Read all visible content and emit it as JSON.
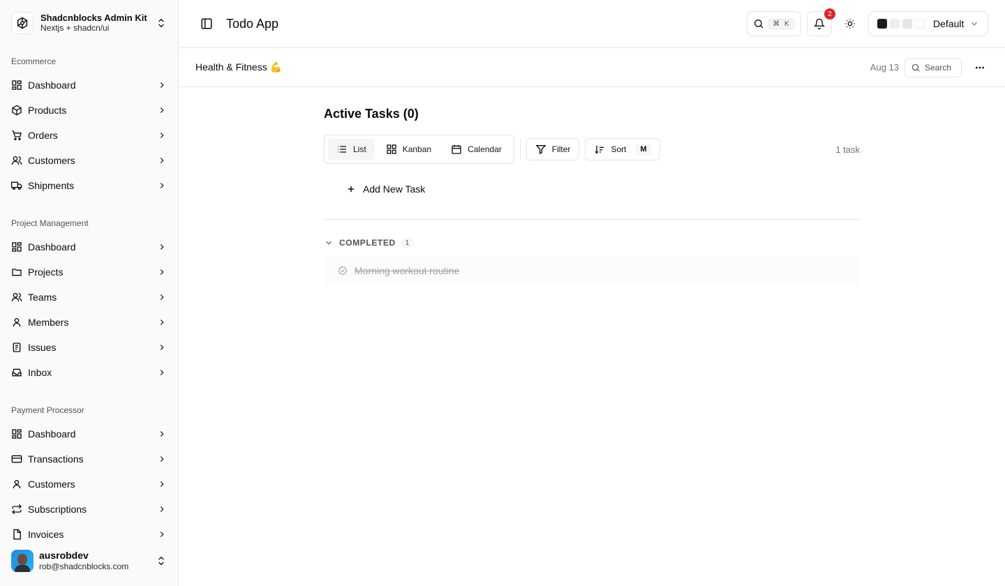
{
  "brand": {
    "title": "Shadcnblocks Admin Kit",
    "subtitle": "Nextjs + shadcn/ui"
  },
  "sidebar": {
    "groups": [
      {
        "label": "Ecommerce",
        "items": [
          {
            "label": "Dashboard",
            "icon": "dashboard-icon"
          },
          {
            "label": "Products",
            "icon": "package-icon"
          },
          {
            "label": "Orders",
            "icon": "cart-icon"
          },
          {
            "label": "Customers",
            "icon": "users-icon"
          },
          {
            "label": "Shipments",
            "icon": "truck-icon"
          }
        ]
      },
      {
        "label": "Project Management",
        "items": [
          {
            "label": "Dashboard",
            "icon": "dashboard-icon"
          },
          {
            "label": "Projects",
            "icon": "folder-icon"
          },
          {
            "label": "Teams",
            "icon": "users-icon"
          },
          {
            "label": "Members",
            "icon": "user-icon"
          },
          {
            "label": "Issues",
            "icon": "issues-icon"
          },
          {
            "label": "Inbox",
            "icon": "inbox-icon"
          }
        ]
      },
      {
        "label": "Payment Processor",
        "items": [
          {
            "label": "Dashboard",
            "icon": "dashboard-icon"
          },
          {
            "label": "Transactions",
            "icon": "credit-card-icon"
          },
          {
            "label": "Customers",
            "icon": "user-icon"
          },
          {
            "label": "Subscriptions",
            "icon": "repeat-icon"
          },
          {
            "label": "Invoices",
            "icon": "file-icon"
          }
        ]
      }
    ]
  },
  "user": {
    "name": "ausrobdev",
    "email": "rob@shadcnblocks.com"
  },
  "topbar": {
    "title": "Todo App",
    "search_shortcut": "⌘ K",
    "notification_count": "2",
    "theme_label": "Default",
    "theme_swatches": [
      "#1c1c1c",
      "#eeeeee",
      "#e6e6e6",
      "#ffffff"
    ]
  },
  "subbar": {
    "list_title": "Health & Fitness 💪",
    "date": "Aug 13",
    "search_placeholder": "Search"
  },
  "content": {
    "section_title": "Active Tasks (0)",
    "views": [
      "List",
      "Kanban",
      "Calendar"
    ],
    "filter_label": "Filter",
    "sort_label": "Sort",
    "sort_shortcut": "M",
    "task_count": "1 task",
    "add_task_label": "Add New Task",
    "completed_label": "COMPLETED",
    "completed_count": "1",
    "completed_tasks": [
      {
        "title": "Morning workout routine"
      }
    ]
  }
}
